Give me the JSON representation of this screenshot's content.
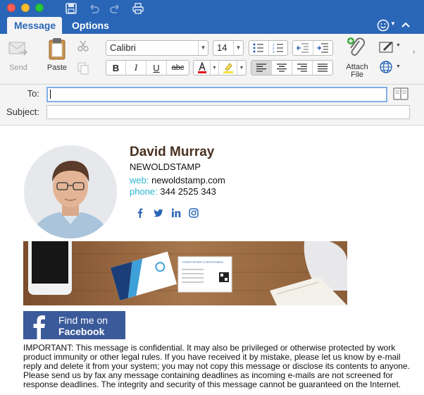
{
  "ribbon": {
    "tabs": [
      "Message",
      "Options"
    ],
    "send_label": "Send",
    "paste_label": "Paste",
    "font_name": "Calibri",
    "font_size": "14",
    "attach_label_1": "Attach",
    "attach_label_2": "File",
    "bold": "B",
    "italic": "I",
    "underline": "U",
    "strike": "abc"
  },
  "compose": {
    "to_label": "To:",
    "subject_label": "Subject:",
    "to_value": "",
    "subject_value": ""
  },
  "signature": {
    "name": "David Murray",
    "company": "NEWOLDSTAMP",
    "web_key": "web:",
    "web_value": "newoldstamp.com",
    "phone_key": "phone:",
    "phone_value": "344 2525 343",
    "social_icons": [
      "facebook-icon",
      "twitter-icon",
      "linkedin-icon",
      "instagram-icon"
    ],
    "card_name": "CHRISTOPHER CHRISTENSEN",
    "fb_line1": "Find me on",
    "fb_line2": "Facebook",
    "disclaimer": "IMPORTANT: This message is confidential. It may also be privileged or otherwise protected by work product immunity or other legal rules. If you have received it by mistake, please let us know by e-mail reply and delete it from your system; you may not copy this message or disclose its contents to anyone. Please send us by fax any message containing deadlines as incoming e-mails are not screened for response deadlines. The integrity and security of this message cannot be guaranteed on the Internet."
  },
  "colors": {
    "ribbon_blue": "#2a66b7",
    "name_brown": "#4a3121",
    "accent_cyan": "#2ab6d0",
    "facebook_blue": "#3b5a9a"
  }
}
